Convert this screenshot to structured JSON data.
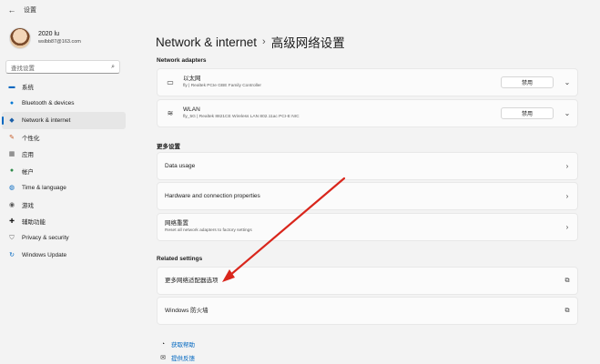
{
  "window": {
    "title": "设置",
    "back_icon": "arrow-left-icon"
  },
  "user": {
    "name": "2020 lu",
    "email": "wslbb87@163.com"
  },
  "search": {
    "placeholder": "查找设置"
  },
  "sidebar": {
    "items": [
      {
        "label": "系统",
        "icon": "monitor-icon",
        "color": "#0067c0"
      },
      {
        "label": "Bluetooth & devices",
        "icon": "bluetooth-icon",
        "color": "#0078d4"
      },
      {
        "label": "Network & internet",
        "icon": "network-icon",
        "color": "#1b5fa8",
        "active": true
      },
      {
        "label": "个性化",
        "icon": "brush-icon",
        "color": "#c65d2b"
      },
      {
        "label": "应用",
        "icon": "apps-icon",
        "color": "#5a5a5a"
      },
      {
        "label": "帐户",
        "icon": "account-icon",
        "color": "#2f8a4a"
      },
      {
        "label": "Time & language",
        "icon": "globe-icon",
        "color": "#0067c0"
      },
      {
        "label": "游戏",
        "icon": "gamepad-icon",
        "color": "#555555"
      },
      {
        "label": "辅助功能",
        "icon": "accessibility-icon",
        "color": "#1b1b1b"
      },
      {
        "label": "Privacy & security",
        "icon": "shield-icon",
        "color": "#6a6a6a"
      },
      {
        "label": "Windows Update",
        "icon": "update-icon",
        "color": "#0067c0"
      }
    ]
  },
  "breadcrumb": {
    "parent": "Network & internet",
    "separator": "›",
    "current": "高级网络设置"
  },
  "adapters": {
    "label": "Network adapters",
    "items": [
      {
        "name": "以太网",
        "detail": "fly | Realtek PCIe GBE Family Controller",
        "button": "禁用",
        "icon": "ethernet-icon"
      },
      {
        "name": "WLAN",
        "detail": "fly_5G | Realtek 8821CE Wireless LAN 802.11ac PCI-E NIC",
        "button": "禁用",
        "icon": "wifi-icon"
      }
    ]
  },
  "more": {
    "label": "更多设置",
    "items": [
      {
        "title": "Data usage",
        "sub": ""
      },
      {
        "title": "Hardware and connection properties",
        "sub": ""
      },
      {
        "title": "网络重置",
        "sub": "Reset all network adapters to factory settings"
      }
    ]
  },
  "related": {
    "label": "Related settings",
    "items": [
      {
        "title": "更多网络适配器选项"
      },
      {
        "title": "Windows 防火墙"
      }
    ]
  },
  "help": {
    "items": [
      {
        "label": "获取帮助",
        "icon": "help-icon"
      },
      {
        "label": "提供反馈",
        "icon": "feedback-icon"
      }
    ]
  },
  "colors": {
    "accent": "#0067c0",
    "annotation_arrow": "#d9261c"
  }
}
